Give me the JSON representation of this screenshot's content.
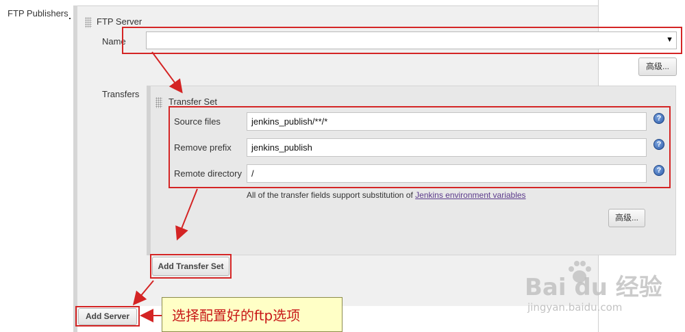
{
  "sidebar": {
    "label": "FTP Publishers"
  },
  "ftp_server": {
    "section_title": "FTP Server",
    "name_label": "Name",
    "name_value": "",
    "dropdown_arrow": "▼",
    "advanced_label": "高级..."
  },
  "transfers": {
    "label": "Transfers",
    "set_title": "Transfer Set",
    "fields": [
      {
        "label": "Source files",
        "value": "jenkins_publish/**/*",
        "help": "?"
      },
      {
        "label": "Remove prefix",
        "value": "jenkins_publish",
        "help": "?"
      },
      {
        "label": "Remote directory",
        "value": "/",
        "help": "?"
      }
    ],
    "note_text": "All of the transfer fields support substitution of ",
    "note_link": "Jenkins environment variables",
    "advanced_label": "高级...",
    "add_transfer_set_label": "Add Transfer Set"
  },
  "add_server_label": "Add Server",
  "annotation": {
    "callout_text": "选择配置好的ftp选项",
    "highlight_color": "#d42424"
  },
  "watermark": {
    "main": "Bai du 经验",
    "sub": "jingyan.baidu.com"
  },
  "colors": {
    "panel_bg": "#f0f0f0",
    "link": "#5b3a8b",
    "help_icon": "#2b5aa8",
    "callout_bg": "#ffffc6"
  }
}
